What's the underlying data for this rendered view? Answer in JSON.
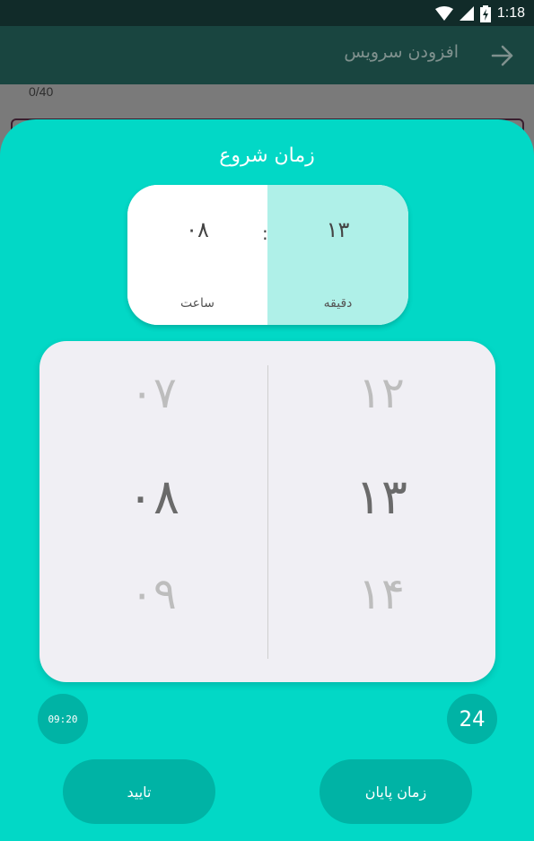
{
  "status_bar": {
    "time": "1:18"
  },
  "app_bar": {
    "title": "افزودن سرویس"
  },
  "background_page": {
    "counter": "0/40"
  },
  "sheet": {
    "title": "زمان شروع",
    "summary": {
      "hour_value": "۰۸",
      "hour_label": "ساعت",
      "separator": ":",
      "minute_value": "۱۳",
      "minute_label": "دقیقه"
    },
    "picker": {
      "hours": {
        "prev": "۰۷",
        "selected": "۰۸",
        "next": "۰۹"
      },
      "minutes": {
        "prev": "۱۲",
        "selected": "۱۳",
        "next": "۱۴"
      }
    },
    "format_buttons": {
      "clock_label": "09:20",
      "h24_label": "24"
    },
    "actions": {
      "confirm": "تایید",
      "end_time": "زمان پایان"
    }
  },
  "colors": {
    "sheet_bg": "#02d8c6",
    "button_bg": "#00b3a5",
    "minute_highlight": "#aff0e8",
    "picker_bg": "#f0eff4"
  },
  "icons": [
    "wifi-icon",
    "signal-icon",
    "battery-charging-icon",
    "back-arrow-icon"
  ]
}
